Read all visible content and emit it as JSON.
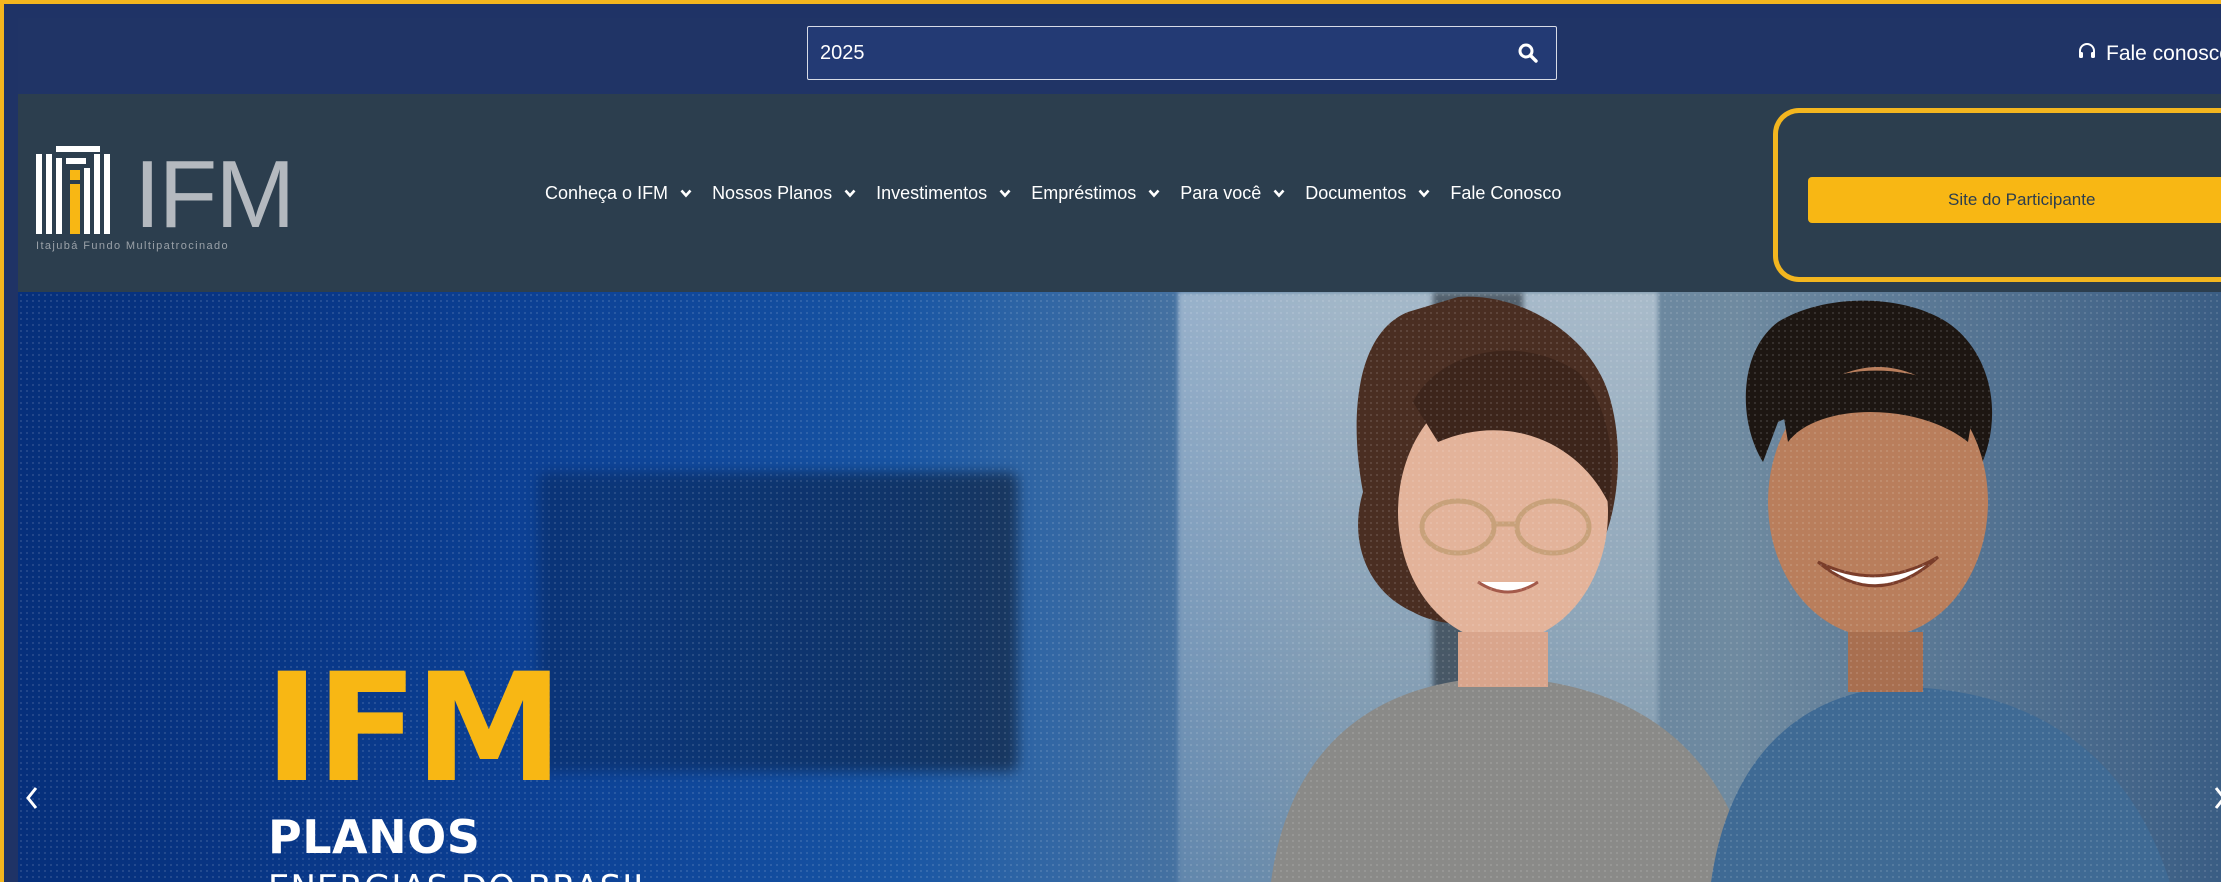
{
  "topbar": {
    "search_value": "2025",
    "contact_label": "Fale conosco"
  },
  "header": {
    "logo_text": "IFM",
    "logo_tagline": "Itajubá Fundo Multipatrocinado",
    "nav": [
      {
        "label": "Conheça o IFM"
      },
      {
        "label": "Nossos Planos"
      },
      {
        "label": "Investimentos"
      },
      {
        "label": "Empréstimos"
      },
      {
        "label": "Para você"
      },
      {
        "label": "Documentos"
      },
      {
        "label": "Fale Conosco"
      }
    ],
    "participant_button": "Site do Participante"
  },
  "hero": {
    "title": "IFM",
    "subtitle": "PLANOS",
    "tagline": "ENERGIAS DO BRASIL"
  },
  "colors": {
    "accent": "#f8b714",
    "topbar": "#203466",
    "header": "#2c3e4e",
    "hero_blue": "#0f4aa6"
  },
  "icons": {
    "search": "search-icon",
    "contact": "headset-icon",
    "chevron": "chevron-down-icon",
    "prev": "chevron-left-icon",
    "next": "chevron-right-icon"
  }
}
